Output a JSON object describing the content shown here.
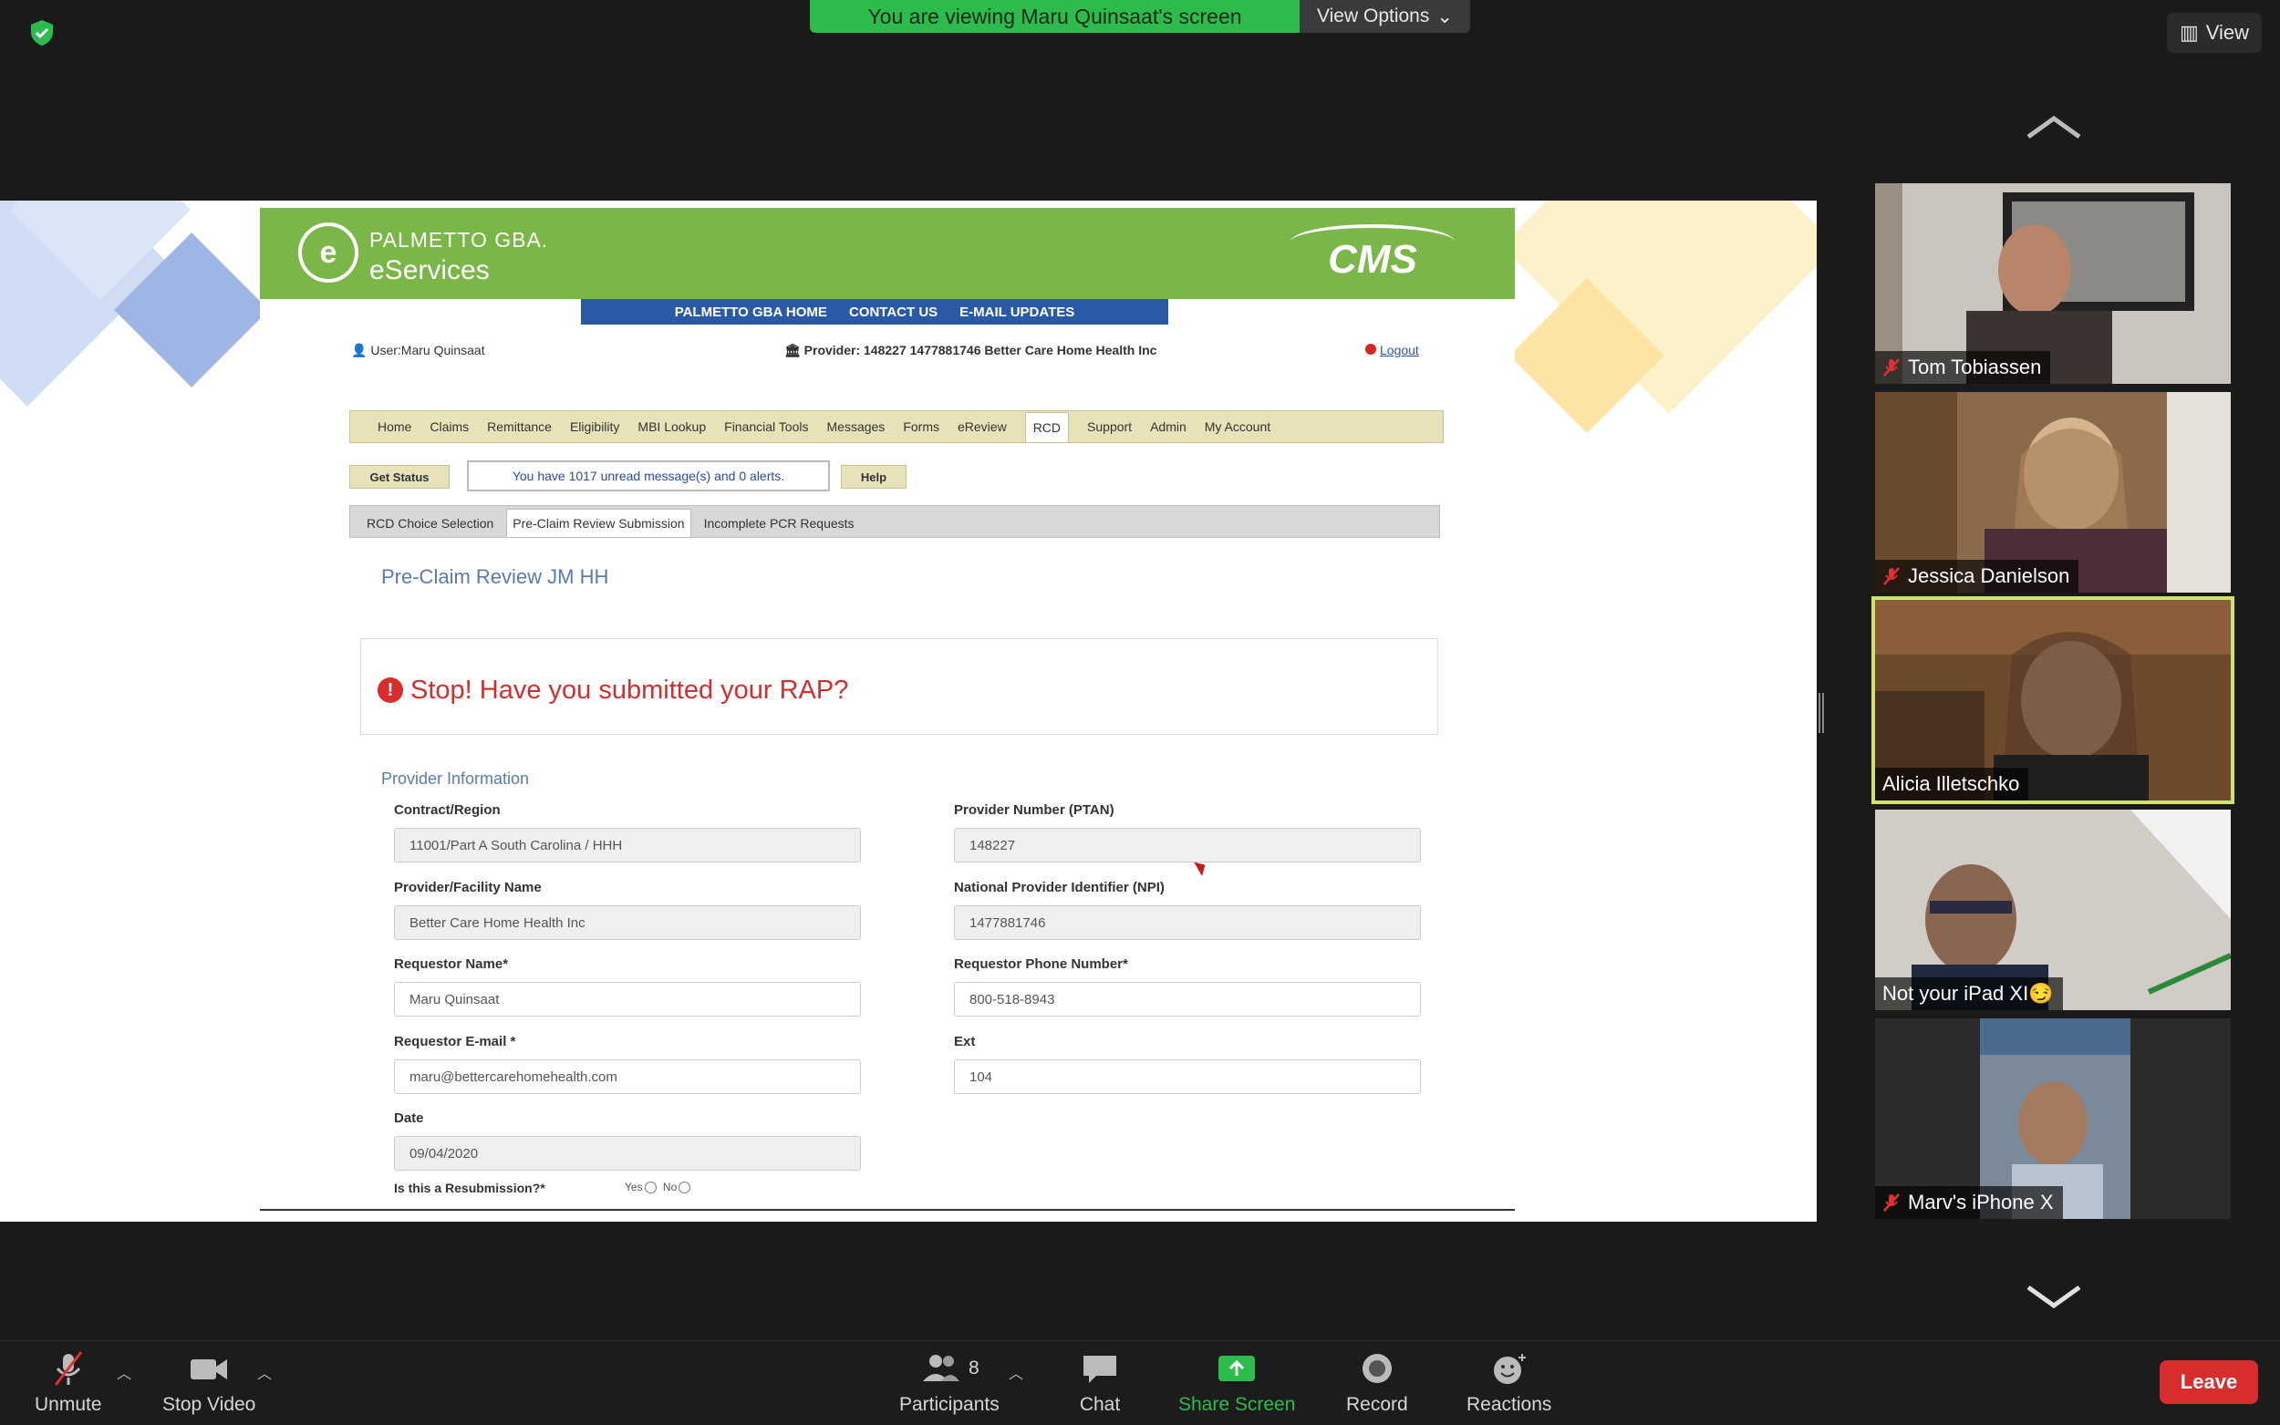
{
  "meeting": {
    "viewing_banner": "You are viewing Maru Quinsaat's screen",
    "view_options_label": "View Options",
    "view_label": "View"
  },
  "shared_page": {
    "brand_name": "PALMETTO GBA.",
    "brand_sub": "eServices",
    "cms_logo": "CMS",
    "topnav": [
      "PALMETTO GBA HOME",
      "CONTACT US",
      "E-MAIL UPDATES"
    ],
    "user_label": "User:Maru  Quinsaat",
    "provider_line": "Provider: 148227   1477881746   Better Care Home Health Inc",
    "logout_label": "Logout",
    "mainnav": [
      "Home",
      "Claims",
      "Remittance",
      "Eligibility",
      "MBI Lookup",
      "Financial Tools",
      "Messages",
      "Forms",
      "eReview",
      "RCD",
      "Support",
      "Admin",
      "My Account"
    ],
    "mainnav_active": "RCD",
    "get_status_label": "Get Status",
    "message_text": "You have 1017 unread message(s) and 0 alerts.",
    "help_label": "Help",
    "subtabs": [
      "RCD Choice Selection",
      "Pre-Claim Review Submission",
      "Incomplete PCR Requests"
    ],
    "subtab_active": "Pre-Claim Review Submission",
    "pcr_title": "Pre-Claim Review JM HH",
    "alert_text": "Stop! Have you submitted your RAP?",
    "section_label": "Provider Information",
    "fields": {
      "contract_region": {
        "label": "Contract/Region",
        "value": "11001/Part A South Carolina / HHH"
      },
      "provider_number": {
        "label": "Provider Number (PTAN)",
        "value": "148227"
      },
      "facility_name": {
        "label": "Provider/Facility Name",
        "value": "Better Care Home Health Inc"
      },
      "npi": {
        "label": "National Provider Identifier (NPI)",
        "value": "1477881746"
      },
      "requestor_name": {
        "label": "Requestor Name*",
        "value": "Maru  Quinsaat"
      },
      "requestor_phone": {
        "label": "Requestor Phone Number*",
        "value": "800-518-8943"
      },
      "requestor_email": {
        "label": "Requestor E-mail *",
        "value": "maru@bettercarehomehealth.com"
      },
      "ext": {
        "label": "Ext",
        "value": "104"
      },
      "date": {
        "label": "Date",
        "value": "09/04/2020"
      }
    },
    "resubmission_label": "Is this a Resubmission?*",
    "resubmission_yes": "Yes",
    "resubmission_no": "No"
  },
  "participants": [
    {
      "name": "Tom Tobiassen",
      "muted": true
    },
    {
      "name": "Jessica Danielson",
      "muted": true
    },
    {
      "name": "Alicia Illetschko",
      "muted": false,
      "active_speaker": true
    },
    {
      "name": "Not your iPad XI😏",
      "muted": false
    },
    {
      "name": "Marv's iPhone X",
      "muted": true
    }
  ],
  "toolbar": {
    "unmute": "Unmute",
    "stop_video": "Stop Video",
    "participants": "Participants",
    "participants_count": "8",
    "chat": "Chat",
    "share_screen": "Share Screen",
    "record": "Record",
    "reactions": "Reactions",
    "leave": "Leave"
  },
  "colors": {
    "banner_green": "#2dbb4e",
    "leave_red": "#d92d2d",
    "active_speaker": "#cfe26b",
    "palmetto_green": "#7ab648"
  }
}
